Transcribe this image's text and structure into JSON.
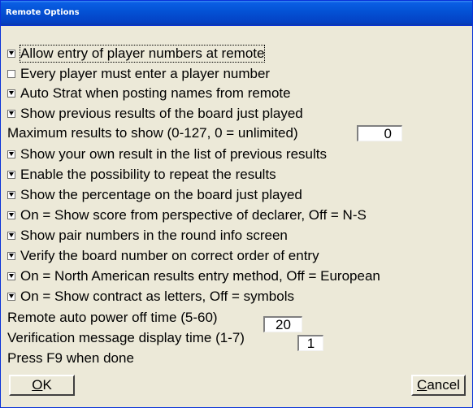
{
  "window": {
    "title": "Remote Options"
  },
  "options": [
    {
      "label": "Allow entry of player numbers at remote",
      "checked": true,
      "focused": true
    },
    {
      "label": "Every player must enter a player number",
      "checked": false
    },
    {
      "label": "Auto Strat when posting names from remote",
      "checked": true
    },
    {
      "label": "Show previous results of the board just played",
      "checked": true
    }
  ],
  "max_results": {
    "label": "Maximum results to show (0-127, 0 = unlimited)",
    "value": "0"
  },
  "options2": [
    {
      "label": "Show your own result in the list of previous results",
      "checked": true
    },
    {
      "label": "Enable the possibility to repeat the results",
      "checked": true
    },
    {
      "label": "Show the percentage on the board just played",
      "checked": true
    },
    {
      "label": "On = Show score from perspective of declarer, Off = N-S",
      "checked": true
    },
    {
      "label": "Show pair numbers in the round info screen",
      "checked": true
    },
    {
      "label": "Verify the board number on correct order of entry",
      "checked": true
    },
    {
      "label": "On = North American results entry method, Off = European",
      "checked": true
    },
    {
      "label": "On = Show contract as letters, Off = symbols",
      "checked": true
    }
  ],
  "power_off": {
    "label": "Remote auto power off time (5-60)",
    "value": "20"
  },
  "verification": {
    "label": "Verification message display time (1-7)",
    "value": "1"
  },
  "hint": "Press F9 when done",
  "buttons": {
    "ok_first": "O",
    "ok_rest": "K",
    "cancel_first": "C",
    "cancel_rest": "ancel"
  }
}
